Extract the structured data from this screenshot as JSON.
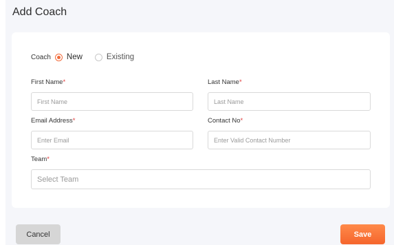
{
  "page": {
    "title": "Add Coach"
  },
  "coach": {
    "label": "Coach",
    "options": [
      {
        "label": "New",
        "selected": true
      },
      {
        "label": "Existing",
        "selected": false
      }
    ]
  },
  "form": {
    "first_name": {
      "label": "First Name",
      "required_mark": "*",
      "placeholder": "First Name",
      "value": ""
    },
    "last_name": {
      "label": "Last Name",
      "required_mark": "*",
      "placeholder": "Last Name",
      "value": ""
    },
    "email": {
      "label": "Email Address",
      "required_mark": "*",
      "placeholder": "Enter Email",
      "value": ""
    },
    "contact": {
      "label": "Contact No",
      "required_mark": "*",
      "placeholder": "Enter Valid Contact Number",
      "value": ""
    },
    "team": {
      "label": "Team",
      "required_mark": "*",
      "placeholder": "Select Team",
      "value": ""
    }
  },
  "actions": {
    "cancel_label": "Cancel",
    "save_label": "Save"
  },
  "colors": {
    "accent": "#f26b3a",
    "required": "#e03b3b",
    "panel_bg": "#f5f6fa",
    "cancel_bg": "#d6d6d6"
  }
}
